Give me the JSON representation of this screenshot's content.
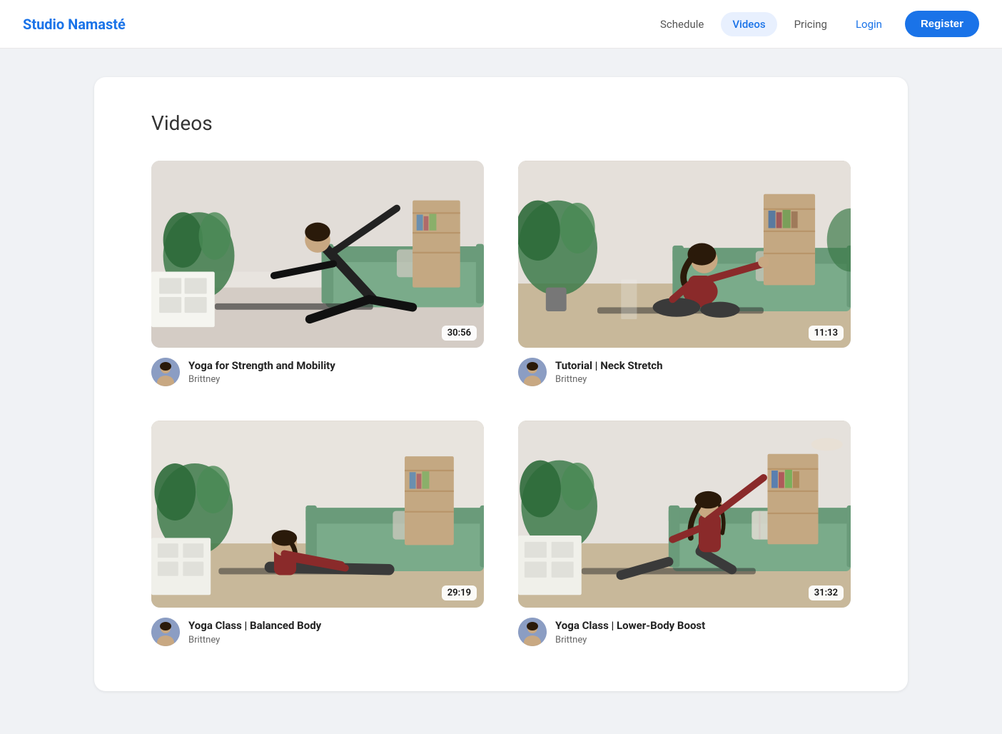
{
  "brand": "Studio Namasté",
  "nav": {
    "links": [
      {
        "label": "Schedule",
        "active": false
      },
      {
        "label": "Videos",
        "active": true
      },
      {
        "label": "Pricing",
        "active": false
      }
    ],
    "login": "Login",
    "register": "Register"
  },
  "page": {
    "title": "Videos"
  },
  "videos": [
    {
      "title": "Yoga for Strength and Mobility",
      "author": "Brittney",
      "duration": "30:56",
      "scene": "warrior"
    },
    {
      "title": "Tutorial | Neck Stretch",
      "author": "Brittney",
      "duration": "11:13",
      "scene": "stretch"
    },
    {
      "title": "Yoga Class | Balanced Body",
      "author": "Brittney",
      "duration": "29:19",
      "scene": "seated"
    },
    {
      "title": "Yoga Class | Lower-Body Boost",
      "author": "Brittney",
      "duration": "31:32",
      "scene": "lunge"
    }
  ]
}
